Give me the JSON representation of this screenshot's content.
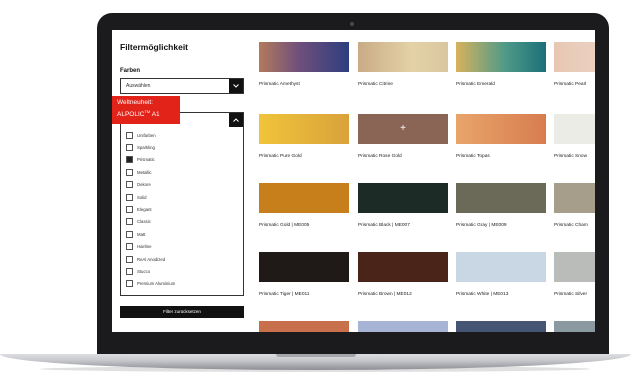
{
  "sidebar": {
    "title": "Filtermöglichkeit",
    "colors_label": "Farben",
    "select_value": "Auswählen",
    "chevron": "chevron-down-icon",
    "badge_line1": "Weltneuheit:",
    "badge_brand": "ALPOLIC",
    "badge_tm": "TM",
    "badge_suffix": " A1",
    "panel_chevron": "chevron-up-icon",
    "options": [
      {
        "label": "Unifarben",
        "checked": false
      },
      {
        "label": "Sparkling",
        "checked": false
      },
      {
        "label": "Prismatic",
        "checked": true
      },
      {
        "label": "Metallic",
        "checked": false
      },
      {
        "label": "Dekore",
        "checked": false
      },
      {
        "label": "Solid",
        "checked": false
      },
      {
        "label": "Elegant",
        "checked": false
      },
      {
        "label": "Classic",
        "checked": false
      },
      {
        "label": "Matt",
        "checked": false
      },
      {
        "label": "Hairline",
        "checked": false
      },
      {
        "label": "ReAl Anodized",
        "checked": false
      },
      {
        "label": "Stucco",
        "checked": false
      },
      {
        "label": "Premium Aluminium",
        "checked": false
      }
    ],
    "reset_label": "Filter zurücksetzen"
  },
  "products": [
    {
      "name": "Prismatic Amethyst",
      "bg": "linear-gradient(90deg,#b27a5c 0%,#6e4f7c 45%,#2e3e7e 100%)"
    },
    {
      "name": "Prismatic Citrine",
      "bg": "linear-gradient(90deg,#c9ab86 0%,#e4d2a6 60%,#d9c6a0 100%)"
    },
    {
      "name": "Prismatic Emerald",
      "bg": "linear-gradient(90deg,#d7b25d 0%,#4e9a88 55%,#1c6f78 100%)"
    },
    {
      "name": "Prismatic Pearl",
      "bg": "linear-gradient(90deg,#e7c7b3 0%,#efdbd0 100%)"
    },
    {
      "name": "Prismatic Pure Gold",
      "bg": "linear-gradient(90deg,#f0c43a 0%,#d9a23a 100%)"
    },
    {
      "name": "Prismatic Rose Gold",
      "bg": "#8a6455",
      "plus": "+"
    },
    {
      "name": "Prismatic Topas",
      "bg": "linear-gradient(90deg,#e8a56b 0%,#d87c4e 100%)"
    },
    {
      "name": "Prismatic Snow",
      "bg": "#ecece6"
    },
    {
      "name": "Prismatic Gold | ME005",
      "bg": "#c67f1a"
    },
    {
      "name": "Prismatic Black | ME007",
      "bg": "#1d2b26"
    },
    {
      "name": "Prismatic Gray | ME009",
      "bg": "#6b6a59"
    },
    {
      "name": "Prismatic Cham",
      "bg": "#a69d8a"
    },
    {
      "name": "Prismatic Tiger | ME011",
      "bg": "#1f1918"
    },
    {
      "name": "Prismatic Brown | ME012",
      "bg": "#4a2418"
    },
    {
      "name": "Prismatic White | ME013",
      "bg": "#c9d7e4"
    },
    {
      "name": "Prismatic Silver",
      "bg": "#b9bcb9"
    },
    {
      "name": "",
      "bg": "#c86f4c"
    },
    {
      "name": "",
      "bg": "#a8b4d6"
    },
    {
      "name": "",
      "bg": "#465574"
    },
    {
      "name": "",
      "bg": "#8b9aa0"
    }
  ]
}
